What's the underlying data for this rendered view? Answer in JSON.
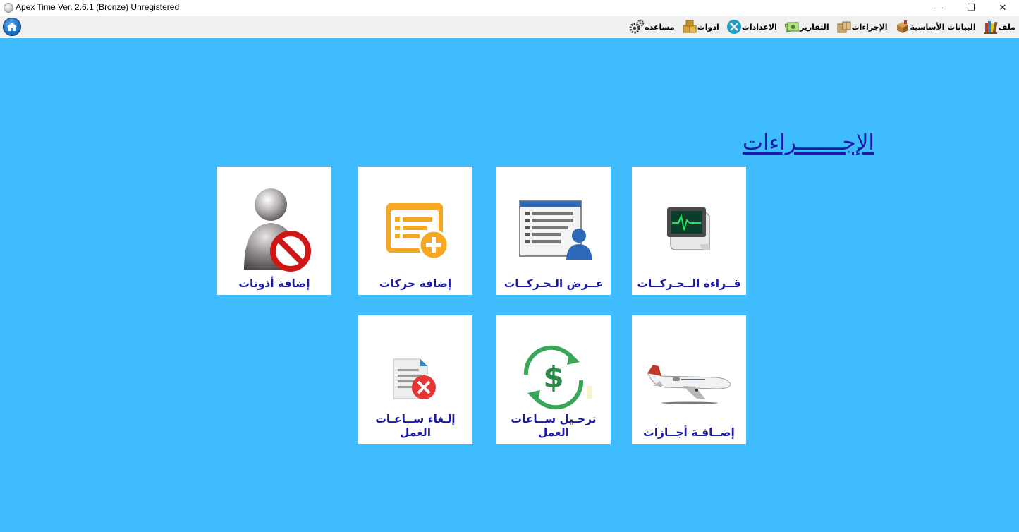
{
  "window": {
    "title": "Apex Time Ver. 2.6.1 (Bronze) Unregistered",
    "controls": {
      "minimize": "—",
      "maximize": "❐",
      "close": "✕"
    }
  },
  "menubar": {
    "home_icon": "home-icon",
    "items": [
      {
        "label": "ملف",
        "icon": "books-icon"
      },
      {
        "label": "البيانات الأساسية",
        "icon": "box-icon"
      },
      {
        "label": "الإجراءات",
        "icon": "package-icon"
      },
      {
        "label": "التقارير",
        "icon": "money-report-icon"
      },
      {
        "label": "الاعدادات",
        "icon": "tools-icon"
      },
      {
        "label": "ادوات",
        "icon": "boxes-icon"
      },
      {
        "label": "مساعده",
        "icon": "gears-icon"
      }
    ]
  },
  "main": {
    "background": "#3fbcfe",
    "section_title": "الإجـــــــراءات",
    "tiles": {
      "read_moves": {
        "line1": "قــراءة الــحـركــات",
        "line2": "",
        "icon": "terminal-reader-icon"
      },
      "view_moves": {
        "line1": "عــرض الـحـركــات",
        "line2": "",
        "icon": "list-user-icon"
      },
      "add_moves": {
        "line1": "إضافة حركات",
        "line2": "",
        "icon": "add-list-icon"
      },
      "add_permissions": {
        "line1": "إضافة أذونات",
        "line2": "",
        "icon": "user-blocked-icon"
      },
      "add_leaves": {
        "line1": "إضــافـة أجــازات",
        "line2": "",
        "icon": "airplane-icon"
      },
      "post_hours": {
        "line1": "ترحـيل ســاعات",
        "line2": "العمل",
        "icon": "dollar-refresh-icon"
      },
      "cancel_hours": {
        "line1": "إلـغاء ســاعـات",
        "line2": "العمل",
        "icon": "document-cancel-icon"
      }
    }
  },
  "colors": {
    "tile_label": "#1a1aa6",
    "section_title": "#1a1aa6",
    "tile_background": "#ffffff"
  }
}
